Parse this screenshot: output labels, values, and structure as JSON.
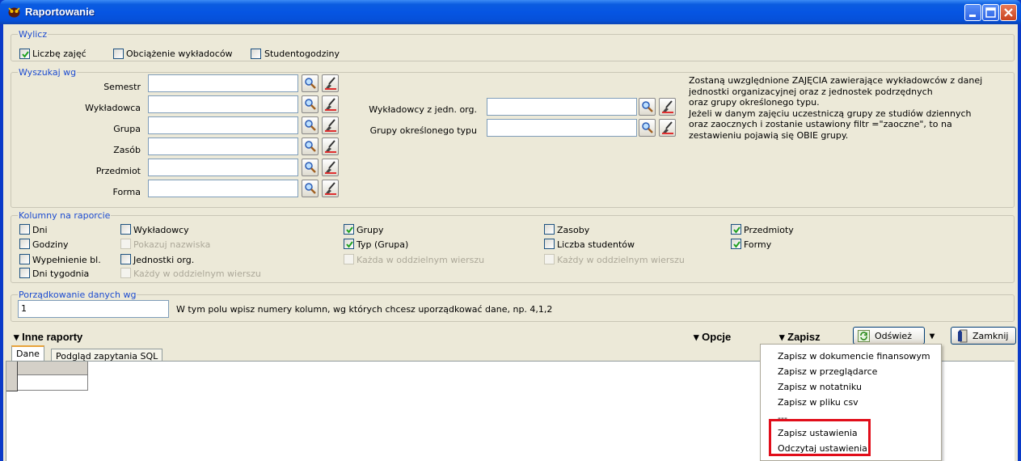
{
  "window": {
    "title": "Raportowanie"
  },
  "wylicz": {
    "label": "Wylicz",
    "options": [
      {
        "label": "Liczbę zajęć",
        "checked": true
      },
      {
        "label": "Obciążenie wykładoców",
        "checked": false
      },
      {
        "label": "Studentogodziny",
        "checked": false
      }
    ]
  },
  "wyszukaj": {
    "label": "Wyszukaj wg",
    "fields": [
      "Semestr",
      "Wykładowca",
      "Grupa",
      "Zasób",
      "Przedmiot",
      "Forma"
    ],
    "right_fields": [
      "Wykładowcy z jedn. org.",
      "Grupy określonego typu"
    ],
    "info": [
      "Zostaną uwzględnione ZAJĘCIA zawierające wykładowców z danej",
      "jednostki organizacyjnej  oraz z jednostek podrzędnych",
      "oraz grupy określonego typu.",
      "Jeżeli w danym zajęciu uczestniczą grupy ze studiów dziennych",
      "oraz zaocznych i zostanie ustawiony filtr =\"zaoczne\", to na",
      "zestawieniu pojawią się OBIE grupy."
    ]
  },
  "kolumny": {
    "label": "Kolumny na raporcie",
    "c1": [
      {
        "label": "Dni",
        "checked": false
      },
      {
        "label": "Godziny",
        "checked": false
      },
      {
        "label": "Wypełnienie bl.",
        "checked": false
      },
      {
        "label": "Dni tygodnia",
        "checked": false
      }
    ],
    "c2": [
      {
        "label": "Wykładowcy",
        "checked": false
      },
      {
        "label": "Pokazuj nazwiska",
        "checked": false,
        "disabled": true
      },
      {
        "label": "Jednostki org.",
        "checked": false
      },
      {
        "label": "Każdy w oddzielnym wierszu",
        "checked": false,
        "disabled": true
      }
    ],
    "c3": [
      {
        "label": "Grupy",
        "checked": true
      },
      {
        "label": "Typ (Grupa)",
        "checked": true
      },
      {
        "label": "Każda w oddzielnym wierszu",
        "checked": false,
        "disabled": true
      }
    ],
    "c4": [
      {
        "label": "Zasoby",
        "checked": false
      },
      {
        "label": "Liczba studentów",
        "checked": false
      },
      {
        "label": "Każdy w oddzielnym wierszu",
        "checked": false,
        "disabled": true
      }
    ],
    "c5": [
      {
        "label": "Przedmioty",
        "checked": true
      },
      {
        "label": "Formy",
        "checked": true
      }
    ]
  },
  "porzadek": {
    "label": "Porządkowanie danych wg",
    "value": "1",
    "hint": "W tym polu wpisz numery kolumn, wg których chcesz uporządkować dane, np. 4,1,2"
  },
  "toolbar": {
    "inne": "Inne raporty",
    "opcje": "Opcje",
    "zapisz": "Zapisz",
    "odswiez": "Odśwież",
    "zamknij": "Zamknij"
  },
  "tabs": [
    "Dane",
    "Podgląd zapytania SQL"
  ],
  "menu": {
    "items": [
      "Zapisz w dokumencie finansowym",
      "Zapisz w przeglądarce",
      "Zapisz w notatniku",
      "Zapisz w pliku csv",
      "---",
      "Zapisz ustawienia",
      "Odczytaj ustawienia"
    ]
  },
  "colors": {
    "titlebar": "#0655e3",
    "highlight": "#e10d1a",
    "group_label": "#1c4bd0"
  }
}
